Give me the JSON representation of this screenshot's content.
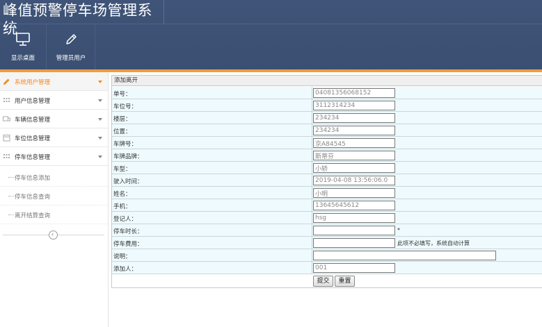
{
  "app": {
    "title": "峰值预警停车场管理系统"
  },
  "toolbar": [
    {
      "label": "显示桌面",
      "icon": "monitor-icon"
    },
    {
      "label": "管理员用户",
      "icon": "pencil-icon"
    }
  ],
  "sidebar": {
    "items": [
      {
        "label": "系统用户管理",
        "icon": "pencil-icon",
        "active": true
      },
      {
        "label": "用户信息管理",
        "icon": "grid-icon"
      },
      {
        "label": "车辆信息管理",
        "icon": "truck-icon"
      },
      {
        "label": "车位信息管理",
        "icon": "calendar-icon"
      },
      {
        "label": "停车信息管理",
        "icon": "grid-icon"
      }
    ],
    "sub_items": [
      {
        "label": "停车信息添加"
      },
      {
        "label": "停车信息查询"
      },
      {
        "label": "离开结算查询"
      }
    ],
    "collapse_symbol": "‹"
  },
  "form": {
    "title": "添加离开",
    "fields": [
      {
        "label": "单号：",
        "value": "04081356068152"
      },
      {
        "label": "车位号：",
        "value": "3112314234"
      },
      {
        "label": "楼层：",
        "value": "234234"
      },
      {
        "label": "位置：",
        "value": "234234"
      },
      {
        "label": "车牌号：",
        "value": "京A84545"
      },
      {
        "label": "车牌品牌：",
        "value": "斯蒂芬"
      },
      {
        "label": "车型：",
        "value": "小轿"
      },
      {
        "label": "驶入时间：",
        "value": "2019-04-08 13:56:06.0"
      },
      {
        "label": "姓名：",
        "value": "小明"
      },
      {
        "label": "手机：",
        "value": "13645645612"
      },
      {
        "label": "登记人：",
        "value": "hsg"
      },
      {
        "label": "停车时长：",
        "value": "",
        "note": "*"
      },
      {
        "label": "停车费用：",
        "value": "",
        "note": "此项不必填写，系统自动计算"
      },
      {
        "label": "说明：",
        "value": ""
      },
      {
        "label": "添加人：",
        "value": "001"
      }
    ],
    "submit_label": "提交",
    "reset_label": "重置"
  }
}
